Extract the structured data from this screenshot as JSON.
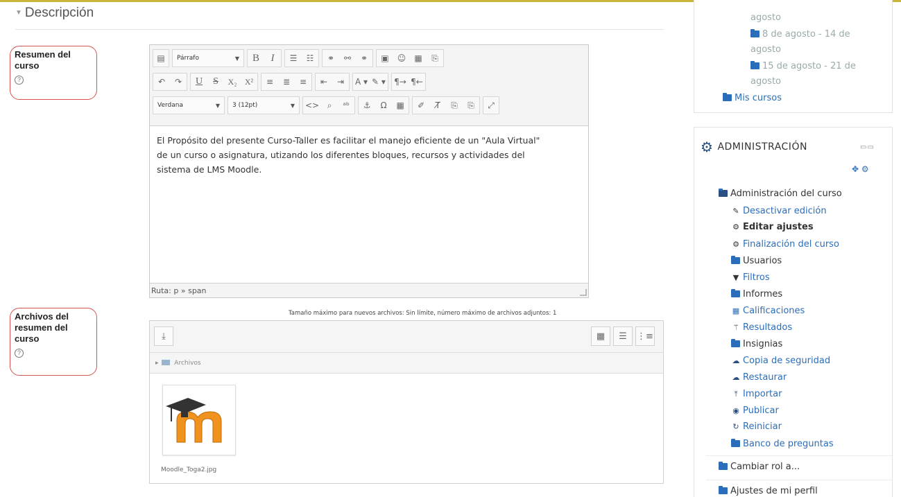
{
  "section": {
    "title": "Descripción"
  },
  "fields": {
    "summary_label_line1": "Resumen del",
    "summary_label_line2": "curso",
    "files_label_line1": "Archivos del",
    "files_label_line2": "resumen del",
    "files_label_line3": "curso",
    "help": "?"
  },
  "editor": {
    "paragraph_format": "Párrafo",
    "font_family": "Verdana",
    "font_size": "3 (12pt)",
    "content": {
      "line1": "El Propósito del presente Curso-Taller es facilitar el manejo eficiente de un \"Aula Virtual\"",
      "line2": "de un curso o asignatura, utizando los diferentes bloques, recursos y actividades del",
      "line3": "sistema de LMS Moodle."
    },
    "path": "Ruta: p » span"
  },
  "filemanager": {
    "limits_note": "Tamaño máximo para nuevos archivos: Sin límite, número máximo de archivos adjuntos: 1",
    "folder": "Archivos",
    "file_name": "Moodle_Toga2.jpg"
  },
  "nav_block": {
    "items": [
      {
        "text": "agosto",
        "kind": "gray"
      },
      {
        "text": "8 de agosto - 14 de",
        "kind": "gray-folder"
      },
      {
        "text": "agosto",
        "kind": "gray"
      },
      {
        "text": "15 de agosto - 21 de",
        "kind": "gray-folder"
      },
      {
        "text": "agosto",
        "kind": "gray"
      },
      {
        "text": "Mis cursos",
        "kind": "link-folder"
      }
    ]
  },
  "admin_block": {
    "title": "ADMINISTRACIÓN",
    "course_admin": "Administración del curso",
    "items": [
      {
        "label": "Desactivar edición",
        "icon": "pencil-icon"
      },
      {
        "label": "Editar ajustes",
        "icon": "gear-icon"
      },
      {
        "label": "Finalización del curso",
        "icon": "gear-icon"
      },
      {
        "label": "Usuarios",
        "icon": "folder-icon"
      },
      {
        "label": "Filtros",
        "icon": "filter-icon"
      },
      {
        "label": "Informes",
        "icon": "folder-icon"
      },
      {
        "label": "Calificaciones",
        "icon": "table-icon"
      },
      {
        "label": "Resultados",
        "icon": "magic-icon"
      },
      {
        "label": "Insignias",
        "icon": "folder-icon"
      },
      {
        "label": "Copia de seguridad",
        "icon": "cloud-upload-icon"
      },
      {
        "label": "Restaurar",
        "icon": "cloud-download-icon"
      },
      {
        "label": "Importar",
        "icon": "import-icon"
      },
      {
        "label": "Publicar",
        "icon": "globe-icon"
      },
      {
        "label": "Reiniciar",
        "icon": "refresh-icon"
      },
      {
        "label": "Banco de preguntas",
        "icon": "folder-icon"
      }
    ],
    "switch_role": "Cambiar rol a...",
    "profile_settings": "Ajustes de mi perfil"
  },
  "colors": {
    "link": "#2a6ebb",
    "highlight_border": "#d9534f",
    "top_line": "#c8b53a"
  }
}
